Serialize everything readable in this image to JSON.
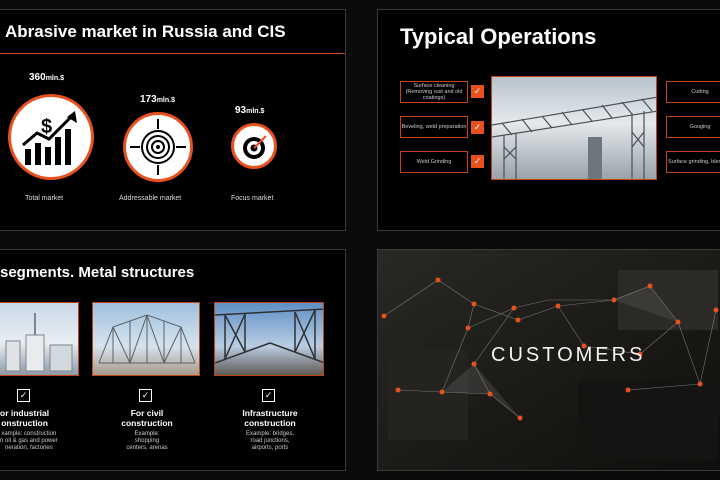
{
  "slide1": {
    "title": "Abrasive market in Russia and CIS",
    "markets": [
      {
        "value": "360",
        "unit": "mln.$",
        "label": "Total market",
        "icon": "chart-dollar-icon"
      },
      {
        "value": "173",
        "unit": "mln.$",
        "label": "Addressable market",
        "icon": "target-arrows-icon"
      },
      {
        "value": "93",
        "unit": "mln.$",
        "label": "Focus market",
        "icon": "bullseye-icon"
      }
    ]
  },
  "slide2": {
    "title": "Typical Operations",
    "left_ops": [
      "Surface cleaning (Removing rust and old coatings)",
      "Beveling, weld preparation",
      "Weld Grinding"
    ],
    "right_ops": [
      "Cutting",
      "Gouging",
      "Surface grinding, blending"
    ]
  },
  "slide3": {
    "title": "segments. Metal structures",
    "segments": [
      {
        "title_line1": "or industrial",
        "title_line2": "onstruction",
        "desc1": "xample: construction",
        "desc2": "n oil & gas and power",
        "desc3": "neration, factories"
      },
      {
        "title_line1": "For civil",
        "title_line2": "construction",
        "desc1": "Example:",
        "desc2": "shopping",
        "desc3": "centers, arenas"
      },
      {
        "title_line1": "Infrastructure",
        "title_line2": "construction",
        "desc1": "Example: bridges,",
        "desc2": "road junctions,",
        "desc3": "airports, ports"
      }
    ]
  },
  "slide4": {
    "title": "CUSTOMERS"
  },
  "colors": {
    "accent": "#e8501e",
    "background": "#000000"
  }
}
